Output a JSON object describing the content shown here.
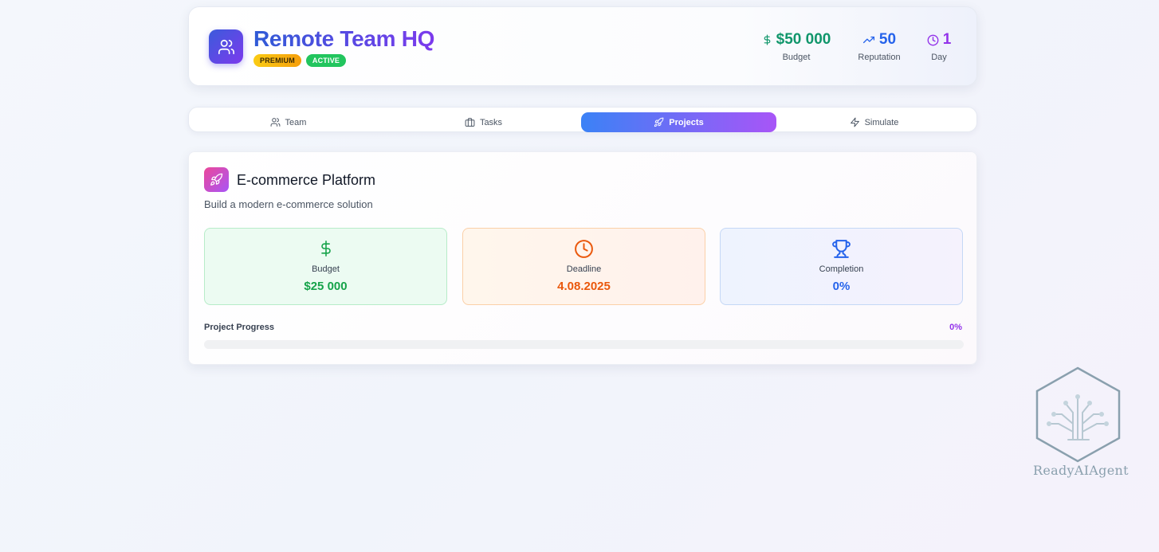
{
  "header": {
    "title": "Remote Team HQ",
    "badges": {
      "premium": "PREMIUM",
      "active": "ACTIVE"
    },
    "stats": {
      "budget": {
        "value": "$50 000",
        "label": "Budget",
        "icon": "dollar-icon"
      },
      "reputation": {
        "value": "50",
        "label": "Reputation",
        "icon": "trending-up-icon"
      },
      "day": {
        "value": "1",
        "label": "Day",
        "icon": "clock-icon"
      }
    }
  },
  "tabs": [
    {
      "label": "Team",
      "icon": "users-icon",
      "active": false
    },
    {
      "label": "Tasks",
      "icon": "briefcase-icon",
      "active": false
    },
    {
      "label": "Projects",
      "icon": "rocket-icon",
      "active": true
    },
    {
      "label": "Simulate",
      "icon": "zap-icon",
      "active": false
    }
  ],
  "project": {
    "title": "E-commerce Platform",
    "description": "Build a modern e-commerce solution",
    "metrics": {
      "budget": {
        "label": "Budget",
        "value": "$25 000",
        "icon": "dollar-icon"
      },
      "deadline": {
        "label": "Deadline",
        "value": "4.08.2025",
        "icon": "clock-icon"
      },
      "completion": {
        "label": "Completion",
        "value": "0%",
        "icon": "trophy-icon"
      }
    },
    "progress": {
      "label": "Project Progress",
      "percent_text": "0%",
      "percent": 0
    }
  },
  "watermark": {
    "text": "ReadyAIAgent"
  },
  "colors": {
    "brand_gradient_start": "#3b82f6",
    "brand_gradient_end": "#a855f7",
    "budget_green": "#16a34a",
    "deadline_orange": "#ea580c",
    "completion_blue": "#2563eb",
    "day_purple": "#9333ea"
  }
}
